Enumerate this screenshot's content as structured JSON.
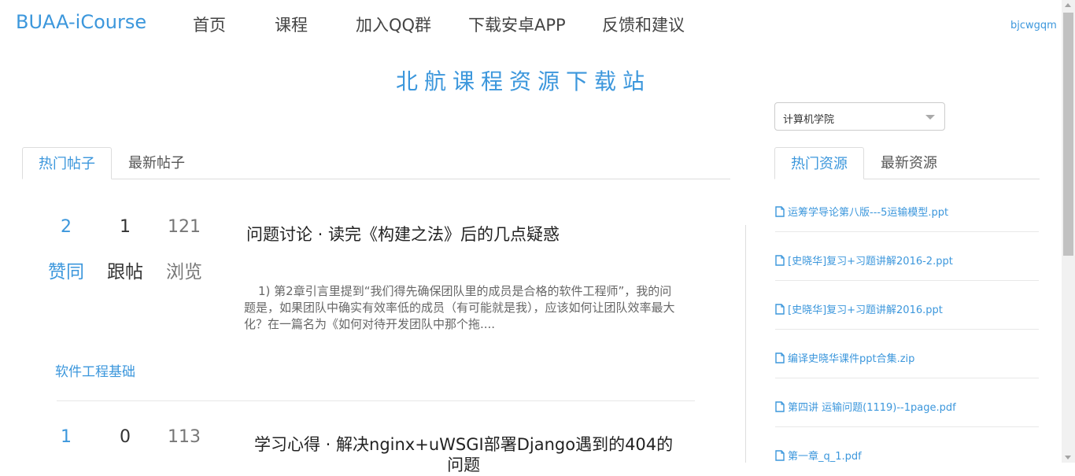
{
  "navbar": {
    "brand": "BUAA-iCourse",
    "items": [
      "首页",
      "课程",
      "加入QQ群",
      "下载安卓APP",
      "反馈和建议"
    ],
    "user": "bjcwgqm"
  },
  "site_title": "北航课程资源下载站",
  "post_tabs": [
    "热门帖子",
    "最新帖子"
  ],
  "stat_labels": {
    "likes": "赞同",
    "replies": "跟帖",
    "views": "浏览"
  },
  "posts": [
    {
      "likes": "2",
      "replies": "1",
      "views": "121",
      "title": "问题讨论 · 读完《构建之法》后的几点疑惑",
      "excerpt_lines": [
        "1) 第2章引言里提到“我们得先确保团队里的成员是合格的软件工程师”，我的问",
        "题是，如果团队中确实有效率低的成员（有可能就是我），应该如何让团队效率最大",
        "化？在一篇名为《如何对待开发团队中那个拖...."
      ],
      "course": "软件工程基础"
    },
    {
      "likes": "1",
      "replies": "0",
      "views": "113",
      "title_lines": [
        "学习心得 · 解决nginx+uWSGI部署Django遇到的404的",
        "问题"
      ]
    }
  ],
  "college_select": {
    "value": "计算机学院"
  },
  "resource_tabs": [
    "热门资源",
    "最新资源"
  ],
  "resources": [
    "运筹学导论第八版---5运输模型.ppt",
    "[史晓华]复习+习题讲解2016-2.ppt",
    "[史晓华]复习+习题讲解2016.ppt",
    "编译史晓华课件ppt合集.zip",
    "第四讲 运输问题(1119)--1page.pdf",
    "第一章_q_1.pdf"
  ]
}
